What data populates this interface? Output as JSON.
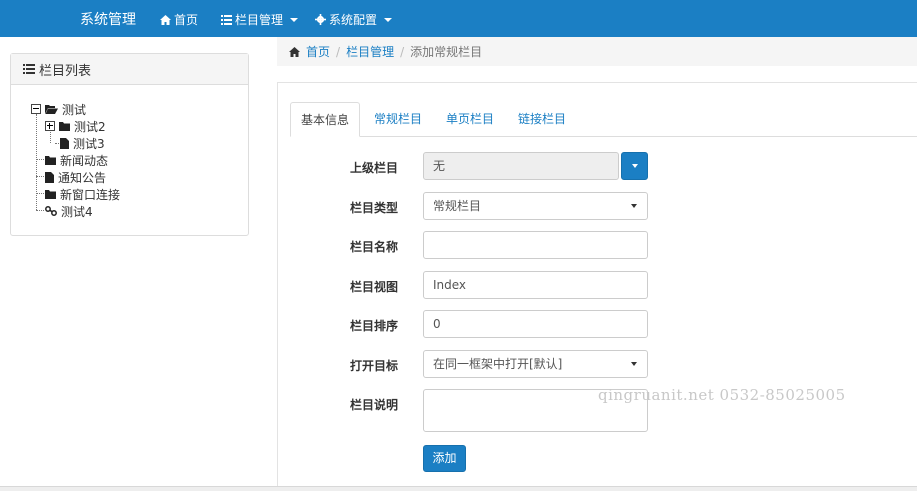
{
  "navbar": {
    "brand": "系统管理",
    "items": [
      {
        "label": "首页",
        "icon": "home-icon"
      },
      {
        "label": "栏目管理",
        "icon": "list-icon"
      },
      {
        "label": "系统配置",
        "icon": "gear-icon"
      }
    ]
  },
  "sidebar": {
    "title": "栏目列表",
    "tree": [
      {
        "label": "测试",
        "icon": "folder-open-icon",
        "expander": "minus",
        "level": 0
      },
      {
        "label": "测试2",
        "icon": "folder-icon",
        "expander": "plus",
        "level": 1
      },
      {
        "label": "测试3",
        "icon": "file-icon",
        "level": 1
      },
      {
        "label": "新闻动态",
        "icon": "folder-icon",
        "level": 0
      },
      {
        "label": "通知公告",
        "icon": "file-icon",
        "level": 0
      },
      {
        "label": "新窗口连接",
        "icon": "folder-icon",
        "level": 0
      },
      {
        "label": "测试4",
        "icon": "link-icon",
        "level": 0
      }
    ]
  },
  "breadcrumb": {
    "home": "首页",
    "section": "栏目管理",
    "current": "添加常规栏目"
  },
  "tabs": [
    "基本信息",
    "常规栏目",
    "单页栏目",
    "链接栏目"
  ],
  "form": {
    "parent_label": "上级栏目",
    "parent_value": "无",
    "type_label": "栏目类型",
    "type_value": "常规栏目",
    "name_label": "栏目名称",
    "name_value": "",
    "view_label": "栏目视图",
    "view_value": "Index",
    "order_label": "栏目排序",
    "order_value": "0",
    "target_label": "打开目标",
    "target_value": "在同一框架中打开[默认]",
    "desc_label": "栏目说明",
    "desc_value": "",
    "submit_label": "添加"
  },
  "watermark": "qingruanit.net 0532-85025005",
  "colors": {
    "primary": "#1b7fc4"
  }
}
